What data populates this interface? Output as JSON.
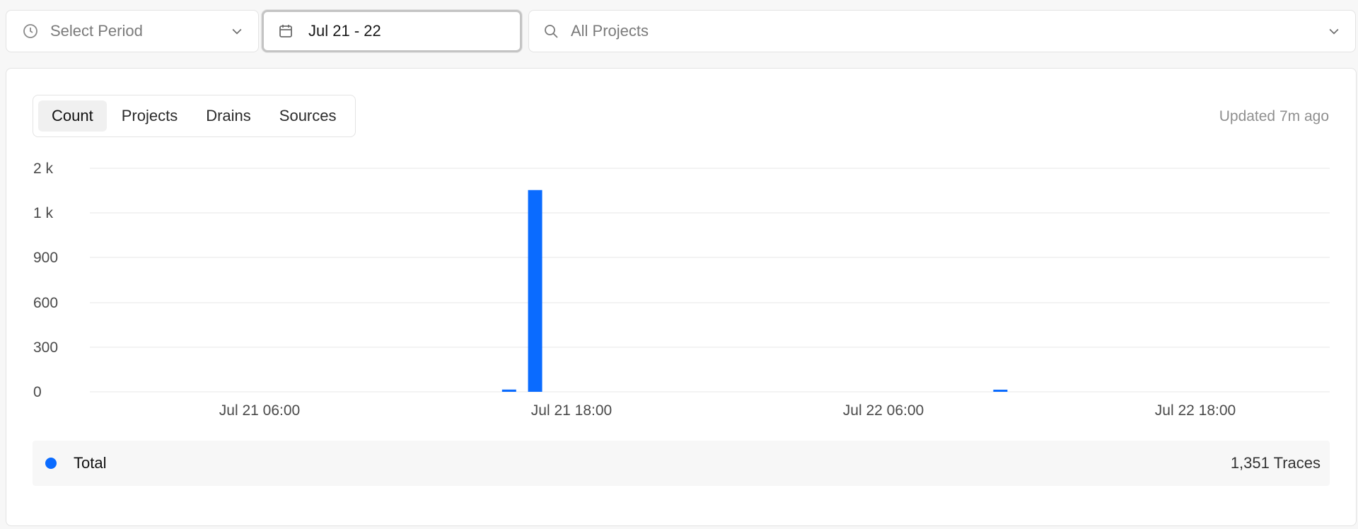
{
  "filters": {
    "period": {
      "label": "Select Period",
      "icon": "clock-icon"
    },
    "date": {
      "label": "Jul 21 - 22",
      "icon": "calendar-icon"
    },
    "projects": {
      "label": "All Projects",
      "icon": "search-icon"
    }
  },
  "tabs": [
    {
      "label": "Count",
      "active": true
    },
    {
      "label": "Projects",
      "active": false
    },
    {
      "label": "Drains",
      "active": false
    },
    {
      "label": "Sources",
      "active": false
    }
  ],
  "updated": "Updated 7m ago",
  "chart_data": {
    "type": "bar",
    "yticks": [
      "2 k",
      "1 k",
      "900",
      "600",
      "300",
      "0"
    ],
    "xticks": [
      "Jul 21 06:00",
      "Jul 21 18:00",
      "Jul 22 06:00",
      "Jul 22 18:00"
    ],
    "tick_values_hours": [
      6,
      18,
      30,
      42
    ],
    "bars": [
      {
        "hour": 15.6,
        "value": 15
      },
      {
        "hour": 16.6,
        "value": 1320
      },
      {
        "hour": 34.5,
        "value": 10
      }
    ],
    "grid": true,
    "color": "#0a6bff"
  },
  "legend": {
    "name": "Total",
    "total": "1,351 Traces",
    "color": "#0a6bff"
  }
}
